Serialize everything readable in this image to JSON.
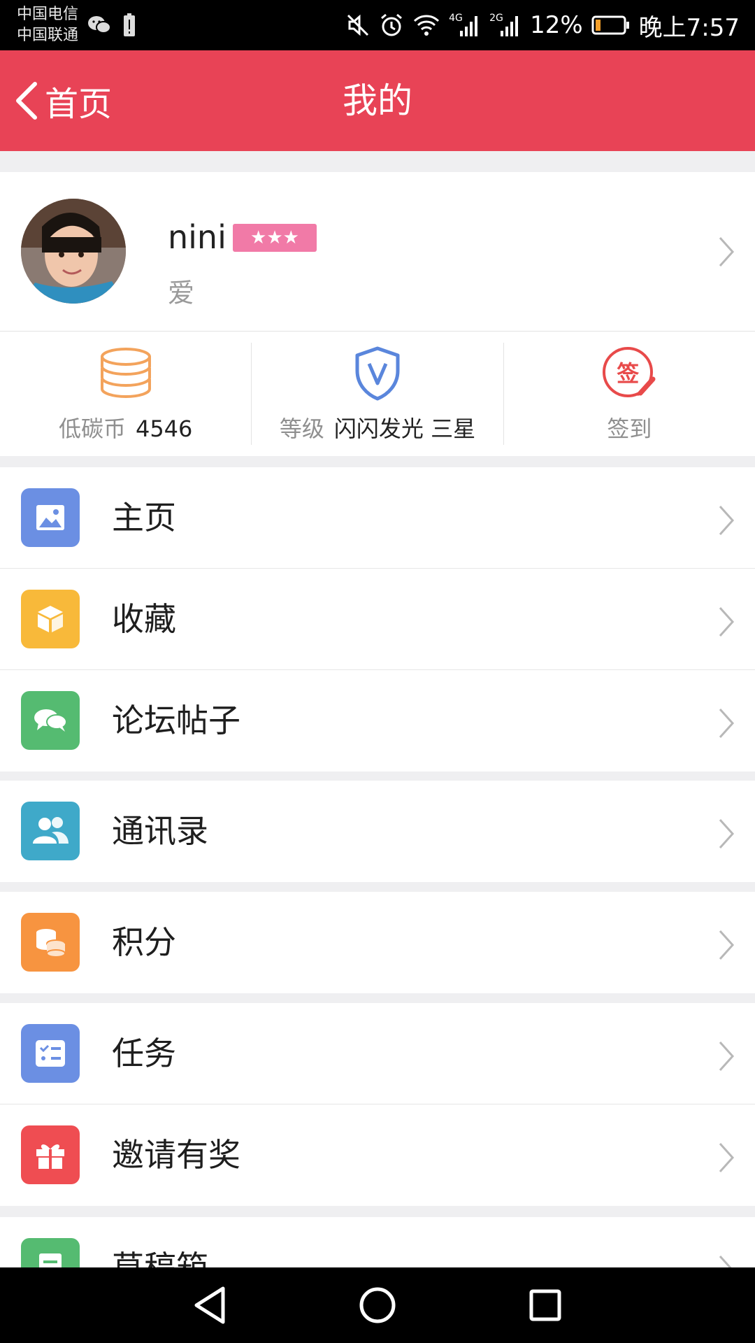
{
  "status_bar": {
    "carrier1": "中国电信",
    "carrier2": "中国联通",
    "net1": "4G",
    "net2": "2G",
    "battery": "12%",
    "time": "晚上7:57"
  },
  "header": {
    "back_label": "首页",
    "title": "我的"
  },
  "profile": {
    "username": "nini",
    "stars": "★★★",
    "bio": "爱"
  },
  "stats": {
    "coins_label": "低碳币",
    "coins_value": "4546",
    "level_label": "等级",
    "level_value": "闪闪发光 三星",
    "checkin_label": "签到",
    "checkin_icon_char": "签"
  },
  "menu": {
    "group1": [
      "主页",
      "收藏",
      "论坛帖子"
    ],
    "group2": [
      "通讯录"
    ],
    "group3": [
      "积分"
    ],
    "group4": [
      "任务",
      "邀请有奖"
    ],
    "group5": [
      "草稿箱"
    ]
  },
  "colors": {
    "header": "#e84356",
    "home_icon": "#6b8fe3",
    "fav_icon": "#f8b93a",
    "forum_icon": "#55bb71",
    "contacts_icon": "#3fa9c9",
    "points_icon": "#f79440",
    "task_icon": "#6b8fe3",
    "invite_icon": "#ef4d52",
    "draft_icon": "#55bb71"
  }
}
